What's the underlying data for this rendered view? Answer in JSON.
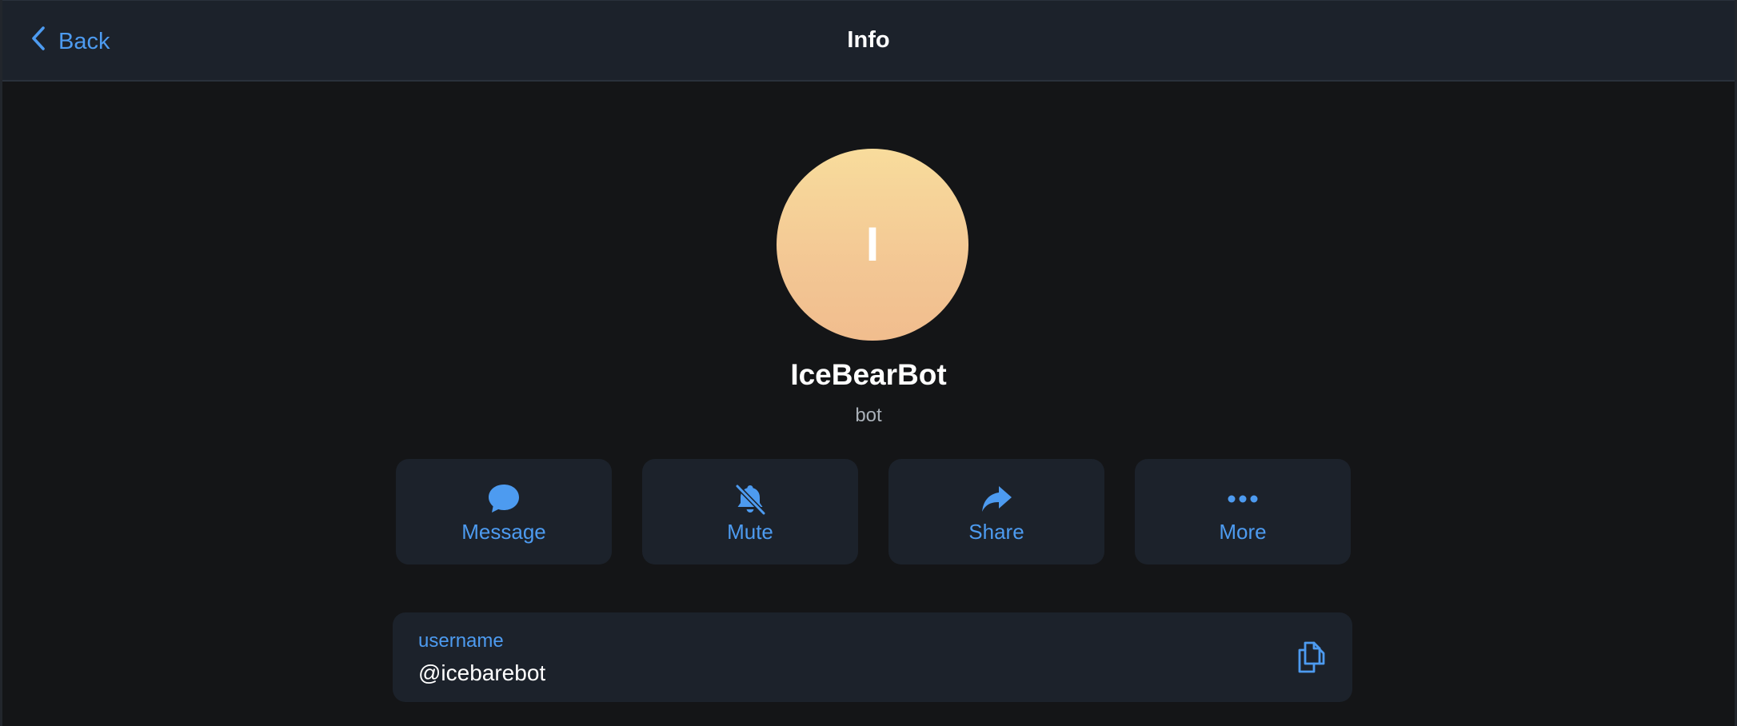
{
  "header": {
    "back_label": "Back",
    "title": "Info"
  },
  "profile": {
    "avatar_letter": "I",
    "name": "IceBearBot",
    "status": "bot"
  },
  "actions": [
    {
      "label": "Message",
      "icon": "message-bubble-icon"
    },
    {
      "label": "Mute",
      "icon": "bell-slash-icon"
    },
    {
      "label": "Share",
      "icon": "share-arrow-icon"
    },
    {
      "label": "More",
      "icon": "ellipsis-icon"
    }
  ],
  "info": {
    "username_label": "username",
    "username_value": "@icebarebot",
    "copy_icon": "copy-icon"
  },
  "colors": {
    "accent": "#4d9bf0",
    "background": "#141517",
    "surface": "#1c222b",
    "avatar_gradient_top": "#f8dc9c",
    "avatar_gradient_bottom": "#f1bd8e"
  }
}
